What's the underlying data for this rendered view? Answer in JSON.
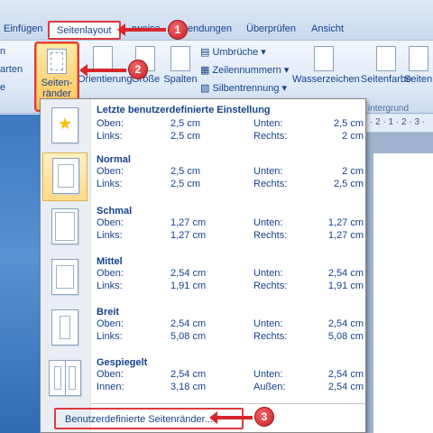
{
  "tabs": [
    {
      "label": "Einfügen"
    },
    {
      "label": "Seitenlayout"
    },
    {
      "label": "rweise"
    },
    {
      "label": "endungen"
    },
    {
      "label": "Überprüfen"
    },
    {
      "label": "Ansicht"
    }
  ],
  "ribbon": {
    "left_items": [
      "n",
      "arten",
      "e"
    ],
    "margins_label_line1": "Seiten-",
    "margins_label_line2": "ränder",
    "orientation": "Orientierung",
    "size": "Größe",
    "columns": "Spalten",
    "breaks": "Umbrüche",
    "line_numbers": "Zeilennummern",
    "hyphenation": "Silbentrennung",
    "watermark": "Wasserzeichen",
    "page_color": "Seitenfarbe",
    "page_border": "Seitenr",
    "group_background": "intergrund"
  },
  "callouts": [
    "1",
    "2",
    "3"
  ],
  "ruler_text": "· 2 · 1 · 2 · 3 ·",
  "margins_menu": {
    "options": [
      {
        "name": "Letzte benutzerdefinierte Einstellung",
        "k1": "Oben:",
        "v1": "2,5 cm",
        "k2": "Unten:",
        "v2": "2,5 cm",
        "k3": "Links:",
        "v3": "2,5 cm",
        "k4": "Rechts:",
        "v4": "2 cm",
        "icon": "star-page-icon"
      },
      {
        "name": "Normal",
        "k1": "Oben:",
        "v1": "2,5 cm",
        "k2": "Unten:",
        "v2": "2 cm",
        "k3": "Links:",
        "v3": "2,5 cm",
        "k4": "Rechts:",
        "v4": "2,5 cm",
        "icon": "normal-margins-icon"
      },
      {
        "name": "Schmal",
        "k1": "Oben:",
        "v1": "1,27 cm",
        "k2": "Unten:",
        "v2": "1,27 cm",
        "k3": "Links:",
        "v3": "1,27 cm",
        "k4": "Rechts:",
        "v4": "1,27 cm",
        "icon": "narrow-margins-icon"
      },
      {
        "name": "Mittel",
        "k1": "Oben:",
        "v1": "2,54 cm",
        "k2": "Unten:",
        "v2": "2,54 cm",
        "k3": "Links:",
        "v3": "1,91 cm",
        "k4": "Rechts:",
        "v4": "1,91 cm",
        "icon": "moderate-margins-icon"
      },
      {
        "name": "Breit",
        "k1": "Oben:",
        "v1": "2,54 cm",
        "k2": "Unten:",
        "v2": "2,54 cm",
        "k3": "Links:",
        "v3": "5,08 cm",
        "k4": "Rechts:",
        "v4": "5,08 cm",
        "icon": "wide-margins-icon"
      },
      {
        "name": "Gespiegelt",
        "k1": "Oben:",
        "v1": "2,54 cm",
        "k2": "Unten:",
        "v2": "2,54 cm",
        "k3": "Innen:",
        "v3": "3,18 cm",
        "k4": "Außen:",
        "v4": "2,54 cm",
        "icon": "mirrored-margins-icon"
      }
    ],
    "custom_label": "Benutzerdefinierte Seitenränder..."
  },
  "colors": {
    "highlight": "#e0393e",
    "text": "#15428b",
    "selected": "#ffd987"
  }
}
